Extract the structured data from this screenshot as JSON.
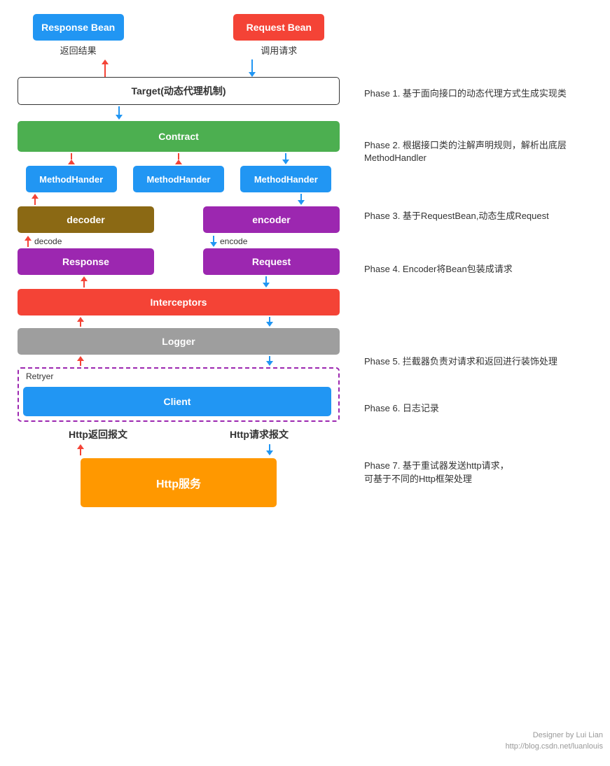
{
  "beans": {
    "response_bean": "Response Bean",
    "request_bean": "Request Bean",
    "return_label": "返回结果",
    "call_label": "调用请求"
  },
  "boxes": {
    "target": "Target(动态代理机制)",
    "contract": "Contract",
    "method_handler": "MethodHander",
    "decoder": "decoder",
    "encoder": "encoder",
    "decode": "decode",
    "encode": "encode",
    "response": "Response",
    "request": "Request",
    "interceptors": "Interceptors",
    "logger": "Logger",
    "retryer": "Retryer",
    "client": "Client",
    "http_return": "Http返回报文",
    "http_request": "Http请求报文",
    "http_service": "Http服务"
  },
  "phases": {
    "phase1": "Phase 1. 基于面向接口的动态代理方式生成实现类",
    "phase2": "Phase 2. 根据接口类的注解声明规则，解析出底层\nMethodHandler",
    "phase3": "Phase 3. 基于RequestBean,动态生成Request",
    "phase4": "Phase 4. Encoder将Bean包装成请求",
    "phase5": "Phase 5. 拦截器负责对请求和返回进行装饰处理",
    "phase6": "Phase 6. 日志记录",
    "phase7": "Phase 7. 基于重试器发送http请求，\n    可基于不同的Http框架处理"
  },
  "watermark": {
    "line1": "Designer by Lui Lian",
    "line2": "http://blog.csdn.net/luanlouis"
  }
}
